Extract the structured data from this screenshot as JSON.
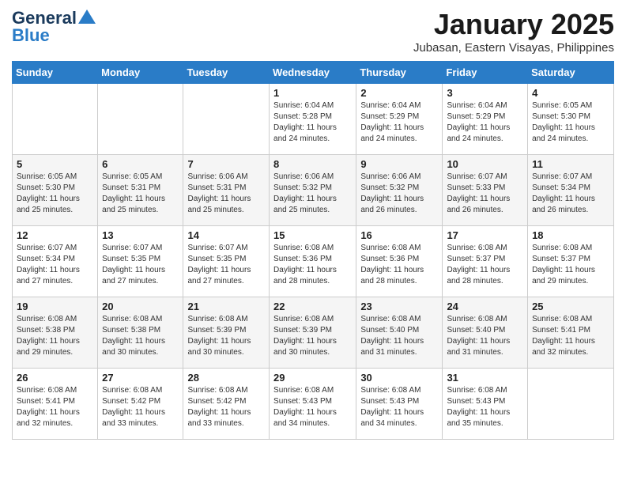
{
  "header": {
    "logo_line1": "General",
    "logo_line2": "Blue",
    "month_title": "January 2025",
    "location": "Jubasan, Eastern Visayas, Philippines"
  },
  "weekdays": [
    "Sunday",
    "Monday",
    "Tuesday",
    "Wednesday",
    "Thursday",
    "Friday",
    "Saturday"
  ],
  "weeks": [
    [
      {
        "day": "",
        "sunrise": "",
        "sunset": "",
        "daylight": ""
      },
      {
        "day": "",
        "sunrise": "",
        "sunset": "",
        "daylight": ""
      },
      {
        "day": "",
        "sunrise": "",
        "sunset": "",
        "daylight": ""
      },
      {
        "day": "1",
        "sunrise": "Sunrise: 6:04 AM",
        "sunset": "Sunset: 5:28 PM",
        "daylight": "Daylight: 11 hours and 24 minutes."
      },
      {
        "day": "2",
        "sunrise": "Sunrise: 6:04 AM",
        "sunset": "Sunset: 5:29 PM",
        "daylight": "Daylight: 11 hours and 24 minutes."
      },
      {
        "day": "3",
        "sunrise": "Sunrise: 6:04 AM",
        "sunset": "Sunset: 5:29 PM",
        "daylight": "Daylight: 11 hours and 24 minutes."
      },
      {
        "day": "4",
        "sunrise": "Sunrise: 6:05 AM",
        "sunset": "Sunset: 5:30 PM",
        "daylight": "Daylight: 11 hours and 24 minutes."
      }
    ],
    [
      {
        "day": "5",
        "sunrise": "Sunrise: 6:05 AM",
        "sunset": "Sunset: 5:30 PM",
        "daylight": "Daylight: 11 hours and 25 minutes."
      },
      {
        "day": "6",
        "sunrise": "Sunrise: 6:05 AM",
        "sunset": "Sunset: 5:31 PM",
        "daylight": "Daylight: 11 hours and 25 minutes."
      },
      {
        "day": "7",
        "sunrise": "Sunrise: 6:06 AM",
        "sunset": "Sunset: 5:31 PM",
        "daylight": "Daylight: 11 hours and 25 minutes."
      },
      {
        "day": "8",
        "sunrise": "Sunrise: 6:06 AM",
        "sunset": "Sunset: 5:32 PM",
        "daylight": "Daylight: 11 hours and 25 minutes."
      },
      {
        "day": "9",
        "sunrise": "Sunrise: 6:06 AM",
        "sunset": "Sunset: 5:32 PM",
        "daylight": "Daylight: 11 hours and 26 minutes."
      },
      {
        "day": "10",
        "sunrise": "Sunrise: 6:07 AM",
        "sunset": "Sunset: 5:33 PM",
        "daylight": "Daylight: 11 hours and 26 minutes."
      },
      {
        "day": "11",
        "sunrise": "Sunrise: 6:07 AM",
        "sunset": "Sunset: 5:34 PM",
        "daylight": "Daylight: 11 hours and 26 minutes."
      }
    ],
    [
      {
        "day": "12",
        "sunrise": "Sunrise: 6:07 AM",
        "sunset": "Sunset: 5:34 PM",
        "daylight": "Daylight: 11 hours and 27 minutes."
      },
      {
        "day": "13",
        "sunrise": "Sunrise: 6:07 AM",
        "sunset": "Sunset: 5:35 PM",
        "daylight": "Daylight: 11 hours and 27 minutes."
      },
      {
        "day": "14",
        "sunrise": "Sunrise: 6:07 AM",
        "sunset": "Sunset: 5:35 PM",
        "daylight": "Daylight: 11 hours and 27 minutes."
      },
      {
        "day": "15",
        "sunrise": "Sunrise: 6:08 AM",
        "sunset": "Sunset: 5:36 PM",
        "daylight": "Daylight: 11 hours and 28 minutes."
      },
      {
        "day": "16",
        "sunrise": "Sunrise: 6:08 AM",
        "sunset": "Sunset: 5:36 PM",
        "daylight": "Daylight: 11 hours and 28 minutes."
      },
      {
        "day": "17",
        "sunrise": "Sunrise: 6:08 AM",
        "sunset": "Sunset: 5:37 PM",
        "daylight": "Daylight: 11 hours and 28 minutes."
      },
      {
        "day": "18",
        "sunrise": "Sunrise: 6:08 AM",
        "sunset": "Sunset: 5:37 PM",
        "daylight": "Daylight: 11 hours and 29 minutes."
      }
    ],
    [
      {
        "day": "19",
        "sunrise": "Sunrise: 6:08 AM",
        "sunset": "Sunset: 5:38 PM",
        "daylight": "Daylight: 11 hours and 29 minutes."
      },
      {
        "day": "20",
        "sunrise": "Sunrise: 6:08 AM",
        "sunset": "Sunset: 5:38 PM",
        "daylight": "Daylight: 11 hours and 30 minutes."
      },
      {
        "day": "21",
        "sunrise": "Sunrise: 6:08 AM",
        "sunset": "Sunset: 5:39 PM",
        "daylight": "Daylight: 11 hours and 30 minutes."
      },
      {
        "day": "22",
        "sunrise": "Sunrise: 6:08 AM",
        "sunset": "Sunset: 5:39 PM",
        "daylight": "Daylight: 11 hours and 30 minutes."
      },
      {
        "day": "23",
        "sunrise": "Sunrise: 6:08 AM",
        "sunset": "Sunset: 5:40 PM",
        "daylight": "Daylight: 11 hours and 31 minutes."
      },
      {
        "day": "24",
        "sunrise": "Sunrise: 6:08 AM",
        "sunset": "Sunset: 5:40 PM",
        "daylight": "Daylight: 11 hours and 31 minutes."
      },
      {
        "day": "25",
        "sunrise": "Sunrise: 6:08 AM",
        "sunset": "Sunset: 5:41 PM",
        "daylight": "Daylight: 11 hours and 32 minutes."
      }
    ],
    [
      {
        "day": "26",
        "sunrise": "Sunrise: 6:08 AM",
        "sunset": "Sunset: 5:41 PM",
        "daylight": "Daylight: 11 hours and 32 minutes."
      },
      {
        "day": "27",
        "sunrise": "Sunrise: 6:08 AM",
        "sunset": "Sunset: 5:42 PM",
        "daylight": "Daylight: 11 hours and 33 minutes."
      },
      {
        "day": "28",
        "sunrise": "Sunrise: 6:08 AM",
        "sunset": "Sunset: 5:42 PM",
        "daylight": "Daylight: 11 hours and 33 minutes."
      },
      {
        "day": "29",
        "sunrise": "Sunrise: 6:08 AM",
        "sunset": "Sunset: 5:43 PM",
        "daylight": "Daylight: 11 hours and 34 minutes."
      },
      {
        "day": "30",
        "sunrise": "Sunrise: 6:08 AM",
        "sunset": "Sunset: 5:43 PM",
        "daylight": "Daylight: 11 hours and 34 minutes."
      },
      {
        "day": "31",
        "sunrise": "Sunrise: 6:08 AM",
        "sunset": "Sunset: 5:43 PM",
        "daylight": "Daylight: 11 hours and 35 minutes."
      },
      {
        "day": "",
        "sunrise": "",
        "sunset": "",
        "daylight": ""
      }
    ]
  ]
}
